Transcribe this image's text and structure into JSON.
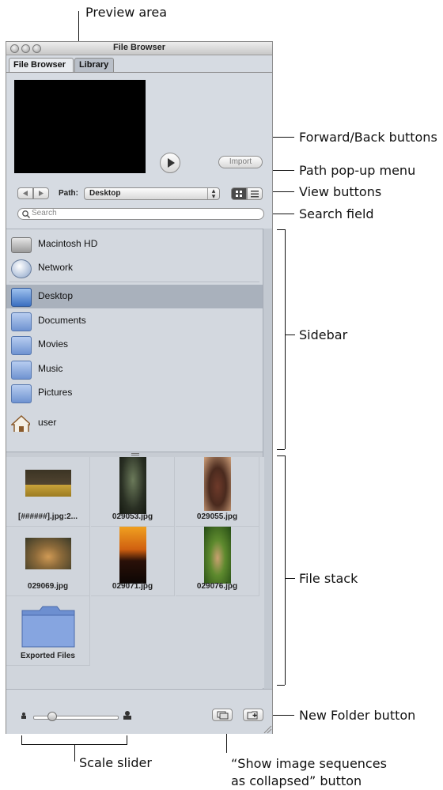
{
  "window": {
    "title": "File Browser",
    "tabs": [
      {
        "label": "File Browser"
      },
      {
        "label": "Library"
      }
    ],
    "import_label": "Import",
    "path_label": "Path:",
    "path_value": "Desktop",
    "search_placeholder": "Search"
  },
  "sidebar": {
    "volumes": [
      {
        "label": "Macintosh HD"
      },
      {
        "label": "Network"
      }
    ],
    "places": [
      {
        "label": "Desktop",
        "selected": true
      },
      {
        "label": "Documents"
      },
      {
        "label": "Movies"
      },
      {
        "label": "Music"
      },
      {
        "label": "Pictures"
      },
      {
        "label": "user"
      }
    ]
  },
  "files": [
    {
      "name": "[######].jpg:2..."
    },
    {
      "name": "029053.jpg"
    },
    {
      "name": "029055.jpg"
    },
    {
      "name": "029069.jpg"
    },
    {
      "name": "029071.jpg"
    },
    {
      "name": "029076.jpg"
    },
    {
      "name": "Exported Files"
    }
  ],
  "annotations": {
    "preview_area": "Preview area",
    "forward_back": "Forward/Back buttons",
    "path_popup": "Path pop-up menu",
    "view_buttons": "View buttons",
    "search_field": "Search field",
    "sidebar": "Sidebar",
    "file_stack": "File stack",
    "new_folder": "New Folder button",
    "scale_slider": "Scale slider",
    "show_sequences_line1": "“Show image sequences",
    "show_sequences_line2": "as collapsed” button"
  },
  "colors": {
    "window_bg": "#d6dbe2",
    "selection": "#a9b1bc",
    "folder_blue": "#7d9bd6"
  }
}
